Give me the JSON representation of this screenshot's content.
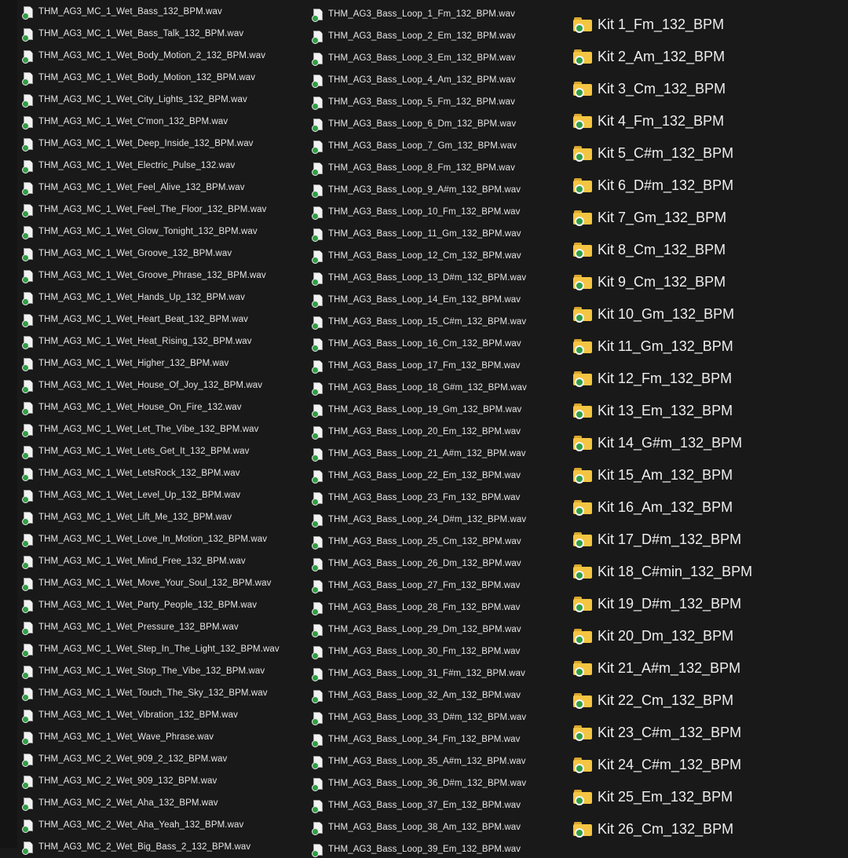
{
  "colors": {
    "background": "#191919",
    "text": "#e6e6e6",
    "folder": "#f4c542",
    "sync_badge": "#2f9e44"
  },
  "icons": {
    "audio_file": "audio-file-icon",
    "folder": "folder-icon",
    "sync_status": "sync-check-icon"
  },
  "wet_files": [
    "THM_AG3_MC_1_Wet_Bass_132_BPM.wav",
    "THM_AG3_MC_1_Wet_Bass_Talk_132_BPM.wav",
    "THM_AG3_MC_1_Wet_Body_Motion_2_132_BPM.wav",
    "THM_AG3_MC_1_Wet_Body_Motion_132_BPM.wav",
    "THM_AG3_MC_1_Wet_City_Lights_132_BPM.wav",
    "THM_AG3_MC_1_Wet_C'mon_132_BPM.wav",
    "THM_AG3_MC_1_Wet_Deep_Inside_132_BPM.wav",
    "THM_AG3_MC_1_Wet_Electric_Pulse_132.wav",
    "THM_AG3_MC_1_Wet_Feel_Alive_132_BPM.wav",
    "THM_AG3_MC_1_Wet_Feel_The_Floor_132_BPM.wav",
    "THM_AG3_MC_1_Wet_Glow_Tonight_132_BPM.wav",
    "THM_AG3_MC_1_Wet_Groove_132_BPM.wav",
    "THM_AG3_MC_1_Wet_Groove_Phrase_132_BPM.wav",
    "THM_AG3_MC_1_Wet_Hands_Up_132_BPM.wav",
    "THM_AG3_MC_1_Wet_Heart_Beat_132_BPM.wav",
    "THM_AG3_MC_1_Wet_Heat_Rising_132_BPM.wav",
    "THM_AG3_MC_1_Wet_Higher_132_BPM.wav",
    "THM_AG3_MC_1_Wet_House_Of_Joy_132_BPM.wav",
    "THM_AG3_MC_1_Wet_House_On_Fire_132.wav",
    "THM_AG3_MC_1_Wet_Let_The_Vibe_132_BPM.wav",
    "THM_AG3_MC_1_Wet_Lets_Get_It_132_BPM.wav",
    "THM_AG3_MC_1_Wet_LetsRock_132_BPM.wav",
    "THM_AG3_MC_1_Wet_Level_Up_132_BPM.wav",
    "THM_AG3_MC_1_Wet_Lift_Me_132_BPM.wav",
    "THM_AG3_MC_1_Wet_Love_In_Motion_132_BPM.wav",
    "THM_AG3_MC_1_Wet_Mind_Free_132_BPM.wav",
    "THM_AG3_MC_1_Wet_Move_Your_Soul_132_BPM.wav",
    "THM_AG3_MC_1_Wet_Party_People_132_BPM.wav",
    "THM_AG3_MC_1_Wet_Pressure_132_BPM.wav",
    "THM_AG3_MC_1_Wet_Step_In_The_Light_132_BPM.wav",
    "THM_AG3_MC_1_Wet_Stop_The_Vibe_132_BPM.wav",
    "THM_AG3_MC_1_Wet_Touch_The_Sky_132_BPM.wav",
    "THM_AG3_MC_1_Wet_Vibration_132_BPM.wav",
    "THM_AG3_MC_1_Wet_Wave_Phrase.wav",
    "THM_AG3_MC_2_Wet_909_2_132_BPM.wav",
    "THM_AG3_MC_2_Wet_909_132_BPM.wav",
    "THM_AG3_MC_2_Wet_Aha_132_BPM.wav",
    "THM_AG3_MC_2_Wet_Aha_Yeah_132_BPM.wav",
    "THM_AG3_MC_2_Wet_Big_Bass_2_132_BPM.wav"
  ],
  "bass_loops": [
    "THM_AG3_Bass_Loop_1_Fm_132_BPM.wav",
    "THM_AG3_Bass_Loop_2_Em_132_BPM.wav",
    "THM_AG3_Bass_Loop_3_Em_132_BPM.wav",
    "THM_AG3_Bass_Loop_4_Am_132_BPM.wav",
    "THM_AG3_Bass_Loop_5_Fm_132_BPM.wav",
    "THM_AG3_Bass_Loop_6_Dm_132_BPM.wav",
    "THM_AG3_Bass_Loop_7_Gm_132_BPM.wav",
    "THM_AG3_Bass_Loop_8_Fm_132_BPM.wav",
    "THM_AG3_Bass_Loop_9_A#m_132_BPM.wav",
    "THM_AG3_Bass_Loop_10_Fm_132_BPM.wav",
    "THM_AG3_Bass_Loop_11_Gm_132_BPM.wav",
    "THM_AG3_Bass_Loop_12_Cm_132_BPM.wav",
    "THM_AG3_Bass_Loop_13_D#m_132_BPM.wav",
    "THM_AG3_Bass_Loop_14_Em_132_BPM.wav",
    "THM_AG3_Bass_Loop_15_C#m_132_BPM.wav",
    "THM_AG3_Bass_Loop_16_Cm_132_BPM.wav",
    "THM_AG3_Bass_Loop_17_Fm_132_BPM.wav",
    "THM_AG3_Bass_Loop_18_G#m_132_BPM.wav",
    "THM_AG3_Bass_Loop_19_Gm_132_BPM.wav",
    "THM_AG3_Bass_Loop_20_Em_132_BPM.wav",
    "THM_AG3_Bass_Loop_21_A#m_132_BPM.wav",
    "THM_AG3_Bass_Loop_22_Em_132_BPM.wav",
    "THM_AG3_Bass_Loop_23_Fm_132_BPM.wav",
    "THM_AG3_Bass_Loop_24_D#m_132_BPM.wav",
    "THM_AG3_Bass_Loop_25_Cm_132_BPM.wav",
    "THM_AG3_Bass_Loop_26_Dm_132_BPM.wav",
    "THM_AG3_Bass_Loop_27_Fm_132_BPM.wav",
    "THM_AG3_Bass_Loop_28_Fm_132_BPM.wav",
    "THM_AG3_Bass_Loop_29_Dm_132_BPM.wav",
    "THM_AG3_Bass_Loop_30_Fm_132_BPM.wav",
    "THM_AG3_Bass_Loop_31_F#m_132_BPM.wav",
    "THM_AG3_Bass_Loop_32_Am_132_BPM.wav",
    "THM_AG3_Bass_Loop_33_D#m_132_BPM.wav",
    "THM_AG3_Bass_Loop_34_Fm_132_BPM.wav",
    "THM_AG3_Bass_Loop_35_A#m_132_BPM.wav",
    "THM_AG3_Bass_Loop_36_D#m_132_BPM.wav",
    "THM_AG3_Bass_Loop_37_Em_132_BPM.wav",
    "THM_AG3_Bass_Loop_38_Am_132_BPM.wav",
    "THM_AG3_Bass_Loop_39_Em_132_BPM.wav"
  ],
  "kits": [
    "Kit 1_Fm_132_BPM",
    "Kit 2_Am_132_BPM",
    "Kit 3_Cm_132_BPM",
    "Kit 4_Fm_132_BPM",
    "Kit 5_C#m_132_BPM",
    "Kit 6_D#m_132_BPM",
    "Kit 7_Gm_132_BPM",
    "Kit 8_Cm_132_BPM",
    "Kit 9_Cm_132_BPM",
    "Kit 10_Gm_132_BPM",
    "Kit 11_Gm_132_BPM",
    "Kit 12_Fm_132_BPM",
    "Kit 13_Em_132_BPM",
    "Kit 14_G#m_132_BPM",
    "Kit 15_Am_132_BPM",
    "Kit 16_Am_132_BPM",
    "Kit 17_D#m_132_BPM",
    "Kit 18_C#min_132_BPM",
    "Kit 19_D#m_132_BPM",
    "Kit 20_Dm_132_BPM",
    "Kit 21_A#m_132_BPM",
    "Kit 22_Cm_132_BPM",
    "Kit 23_C#m_132_BPM",
    "Kit 24_C#m_132_BPM",
    "Kit 25_Em_132_BPM",
    "Kit 26_Cm_132_BPM"
  ]
}
